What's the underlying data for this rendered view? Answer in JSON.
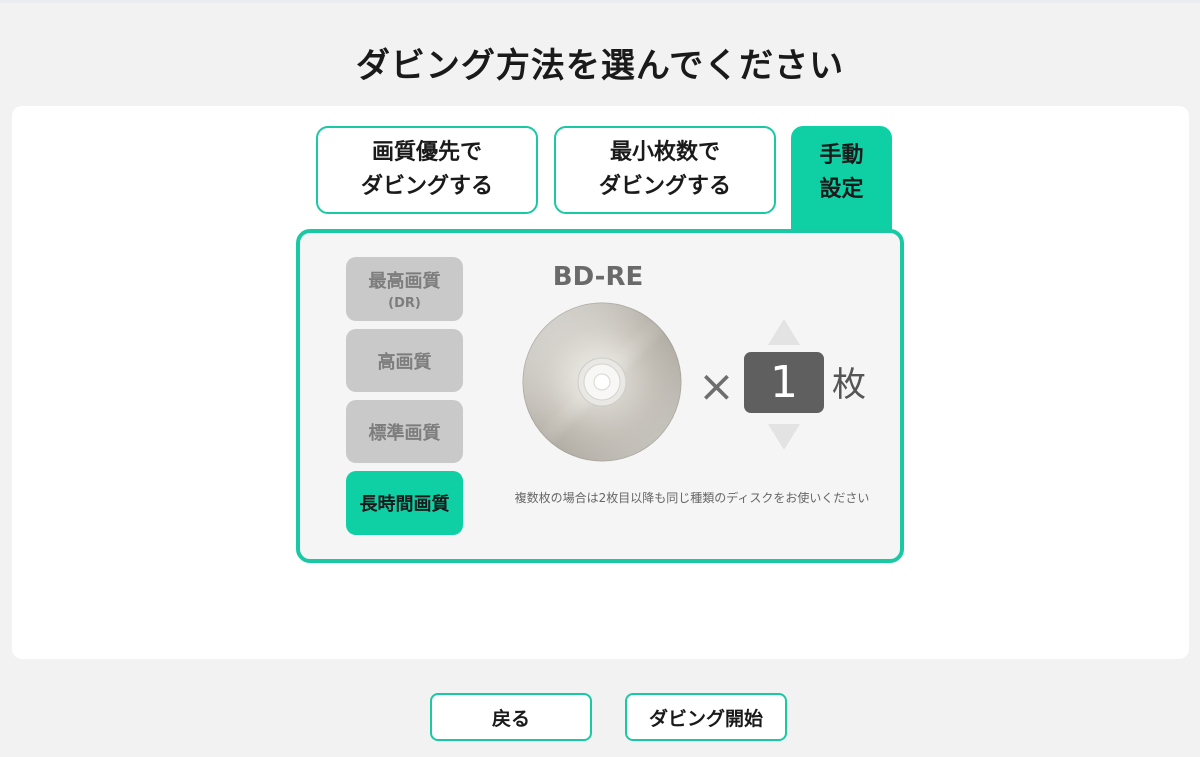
{
  "page": {
    "title": "ダビング方法を選んでください"
  },
  "modes": {
    "quality_first": {
      "line1": "画質優先で",
      "line2": "ダビングする"
    },
    "min_discs": {
      "line1": "最小枚数で",
      "line2": "ダビングする"
    },
    "manual": {
      "line1": "手動",
      "line2": "設定"
    }
  },
  "quality_options": [
    {
      "label": "最高画質",
      "sub": "(DR)"
    },
    {
      "label": "高画質"
    },
    {
      "label": "標準画質"
    },
    {
      "label": "長時間画質",
      "selected": true
    }
  ],
  "disc": {
    "type": "BD-RE",
    "times_symbol": "×",
    "count": "1",
    "unit": "枚",
    "icon": "disc-icon"
  },
  "note": "複数枚の場合は2枚目以降も同じ種類のディスクをお使いください",
  "footer": {
    "back_label": "戻る",
    "start_label": "ダビング開始"
  },
  "colors": {
    "accent": "#0fcfa5",
    "accent_border": "#19c9a4",
    "inactive_option": "#c9c9c9",
    "count_box": "#5f5f5f"
  }
}
